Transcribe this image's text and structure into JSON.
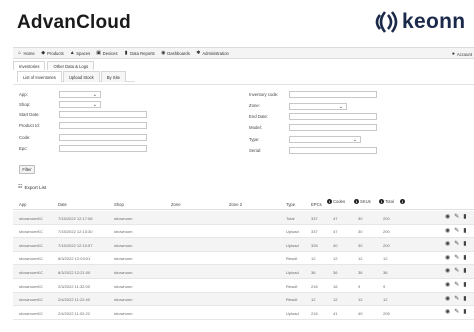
{
  "app": {
    "title": "AdvanCloud",
    "logo_text": "keonn"
  },
  "nav": {
    "items": [
      {
        "label": "Home",
        "icon": "home-icon"
      },
      {
        "label": "Products",
        "icon": "tag-icon"
      },
      {
        "label": "Spaces",
        "icon": "sitemap-icon"
      },
      {
        "label": "Devices",
        "icon": "device-icon"
      },
      {
        "label": "Data Reports",
        "icon": "bar-chart-icon"
      },
      {
        "label": "Dashboards",
        "icon": "dashboard-icon"
      },
      {
        "label": "Administration",
        "icon": "gear-icon"
      }
    ],
    "user_label": "Account"
  },
  "subtabs": [
    "Inventories",
    "Other Data & Logs"
  ],
  "tabs": [
    "List of Inventories",
    "Upload Stock",
    "By Site"
  ],
  "filters": {
    "left": [
      {
        "label": "App:",
        "kind": "select",
        "value": ""
      },
      {
        "label": "Shop:",
        "kind": "select",
        "value": ""
      },
      {
        "label": "Start Date:",
        "kind": "input",
        "value": ""
      },
      {
        "label": "Product Id:",
        "kind": "input",
        "value": ""
      },
      {
        "label": "Code:",
        "kind": "input",
        "value": ""
      },
      {
        "label": "Epc:",
        "kind": "input",
        "value": ""
      }
    ],
    "right": [
      {
        "label": "Inventory code:",
        "kind": "input",
        "value": ""
      },
      {
        "label": "Zone:",
        "kind": "select",
        "value": ""
      },
      {
        "label": "End Date:",
        "kind": "input",
        "value": ""
      },
      {
        "label": "Model:",
        "kind": "input",
        "value": ""
      },
      {
        "label": "Type:",
        "kind": "select",
        "value": ""
      },
      {
        "label": "Serial:",
        "kind": "input",
        "value": ""
      }
    ],
    "find_label": "Filter"
  },
  "export_label": "Export List",
  "table": {
    "columns": [
      "App",
      "Date",
      "Shop",
      "Zone",
      "Zone 2",
      "Type",
      "EPCs",
      "Codes",
      "SKUs",
      "Total"
    ],
    "rows": [
      [
        "showroomKC",
        "7/15/2022 12:17:08",
        "showroom",
        "",
        "",
        "Total",
        "337",
        "47",
        "30",
        "200"
      ],
      [
        "showroomKC",
        "7/15/2022 12:13:30",
        "showroom",
        "",
        "",
        "Upload",
        "337",
        "47",
        "30",
        "200"
      ],
      [
        "showroomKC",
        "7/15/2022 12:10:57",
        "showroom",
        "",
        "",
        "Upload",
        "326",
        "40",
        "30",
        "200"
      ],
      [
        "showroomKC",
        "8/3/2022 12:03:01",
        "showroom",
        "",
        "",
        "Result",
        "12",
        "12",
        "12",
        "12"
      ],
      [
        "showroomKC",
        "8/3/2022 12:21:00",
        "showroom",
        "",
        "",
        "Upload",
        "36",
        "36",
        "36",
        "36"
      ],
      [
        "showroomKC",
        "2/3/2022 11:32:00",
        "showroom",
        "",
        "",
        "Result",
        "216",
        "16",
        "9",
        "9"
      ],
      [
        "showroomKC",
        "2/4/2022 11:22:40",
        "showroom",
        "",
        "",
        "Result",
        "12",
        "12",
        "12",
        "12"
      ],
      [
        "showroomKC",
        "2/4/2022 11:02:22",
        "showroom",
        "",
        "",
        "Upload",
        "216",
        "41",
        "40",
        "205"
      ]
    ]
  }
}
